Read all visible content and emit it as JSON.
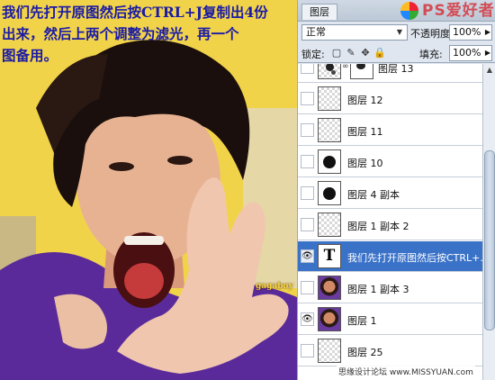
{
  "caption": {
    "line1": "我们先打开原图然后按CTRL+J复制出4份",
    "line2": "出来，然后上两个调整为滤光，再一个",
    "line3": "图备用。"
  },
  "watermark_text": "gagaboy",
  "panel": {
    "tab_label": "图层",
    "brand_text": "PS爱好者",
    "blend_mode": "正常",
    "opacity_label": "不透明度:",
    "opacity_value": "100%",
    "lock_label": "锁定:",
    "fill_label": "填充:",
    "fill_value": "100%",
    "layers": [
      {
        "name": "图层 13",
        "visible": false,
        "thumb": "dots",
        "has_mask": true,
        "selected": false
      },
      {
        "name": "图层 12",
        "visible": false,
        "thumb": "transparent",
        "has_mask": false,
        "selected": false
      },
      {
        "name": "图层 11",
        "visible": false,
        "thumb": "transparent",
        "has_mask": false,
        "selected": false
      },
      {
        "name": "图层 10",
        "visible": false,
        "thumb": "ink",
        "has_mask": false,
        "selected": false
      },
      {
        "name": "图层 4 副本",
        "visible": false,
        "thumb": "ink",
        "has_mask": false,
        "selected": false
      },
      {
        "name": "图层 1 副本 2",
        "visible": false,
        "thumb": "transparent",
        "has_mask": false,
        "selected": false
      },
      {
        "name": "我们先打开原图然后按CTRL+...",
        "visible": true,
        "thumb": "text",
        "thumb_glyph": "T",
        "has_mask": false,
        "selected": true
      },
      {
        "name": "图层 1 副本 3",
        "visible": false,
        "thumb": "photo",
        "has_mask": false,
        "selected": false
      },
      {
        "name": "图层 1",
        "visible": true,
        "thumb": "photo",
        "has_mask": false,
        "selected": false
      },
      {
        "name": "图层 25",
        "visible": false,
        "thumb": "transparent",
        "has_mask": false,
        "selected": false
      }
    ],
    "eye_glyph": "👁"
  },
  "footer": "思缘设计论坛 www.MISSYUAN.com"
}
